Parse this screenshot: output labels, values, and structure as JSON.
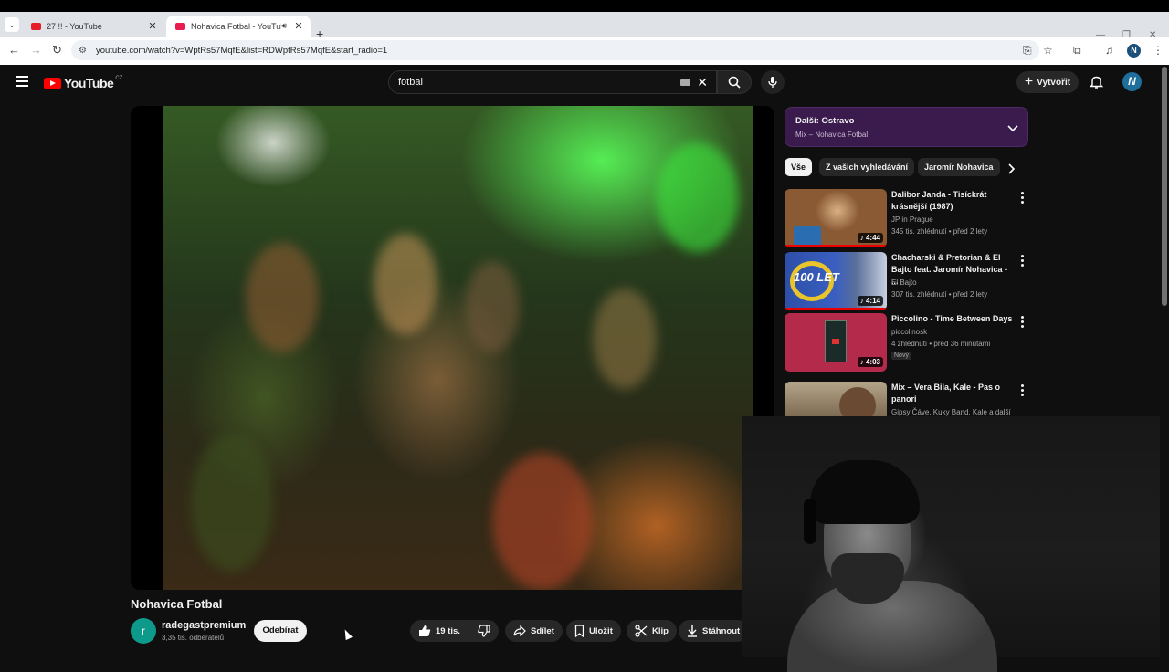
{
  "browser": {
    "tabs": [
      {
        "title": "27 !! - YouTube",
        "active": false
      },
      {
        "title": "Nohavica Fotbal - YouTube",
        "active": true
      }
    ],
    "url": "youtube.com/watch?v=WptRs57MqfE&list=RDWptRs57MqfE&start_radio=1"
  },
  "header": {
    "logo_text": "YouTube",
    "country_code": "CZ",
    "search_value": "fotbal",
    "create_label": "Vytvořit",
    "avatar_letter": "N"
  },
  "video": {
    "title": "Nohavica Fotbal",
    "channel": {
      "name": "radegastpremium",
      "subscribers": "3,35 tis. odběratelů",
      "avatar_letter": "r"
    },
    "subscribe_label": "Odebírat",
    "like_count": "19 tis.",
    "share_label": "Sdílet",
    "save_label": "Uložit",
    "clip_label": "Klip",
    "download_label": "Stáhnout"
  },
  "sidebar": {
    "next": {
      "title": "Další: Ostravo",
      "subtitle": "Mix – Nohavica Fotbal"
    },
    "chips": [
      "Vše",
      "Z vašich vyhledávání",
      "Jaromír Nohavica"
    ],
    "recommendations": [
      {
        "title": "Dalibor Janda - Tisíckrát krásnější (1987)",
        "channel": "JP in Prague",
        "meta": "345 tis. zhlédnutí • před 2 lety",
        "duration": "4:44",
        "badge": ""
      },
      {
        "title": "Chacharski & Pretorian & El Bajto feat. Jaromír Nohavica - ...",
        "channel": "El Bajto",
        "meta": "307 tis. zhlédnutí • před 2 lety",
        "duration": "4:14",
        "badge": ""
      },
      {
        "title": "Piccolino - Time Between Days",
        "channel": "piccolinosk",
        "meta": "4 zhlédnutí • před 36 minutami",
        "duration": "4:03",
        "badge": "Nový"
      },
      {
        "title": "Mix – Vera Bila, Kale - Pas o panori",
        "channel": "Gipsy Čáve, Kuky Band, Kale a další",
        "meta": "",
        "duration": "",
        "badge": ""
      }
    ]
  },
  "thumb_text": {
    "rec2_overlay": "100 LET"
  },
  "colors": {
    "background": "#0f0f0f",
    "youtube_red": "#ff0000",
    "next_box": "#3b1b4e"
  }
}
